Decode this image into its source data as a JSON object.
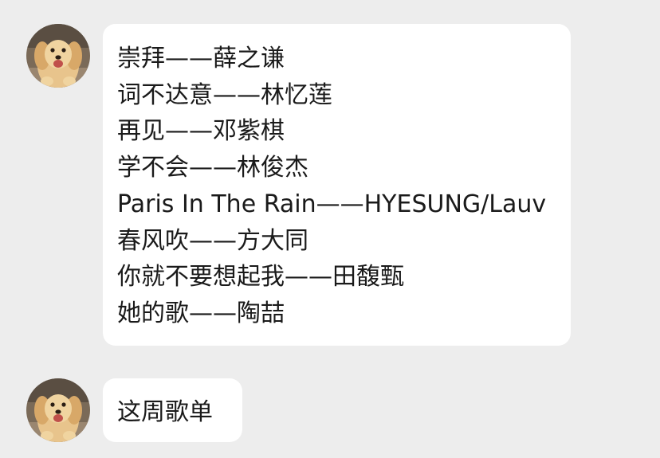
{
  "messages": [
    {
      "sender_avatar": "golden-retriever-puppy-avatar",
      "lines": [
        "崇拜——薛之谦",
        "词不达意——林忆莲",
        "再见——邓紫棋",
        "学不会——林俊杰",
        "Paris In The Rain——HYESUNG/Lauv",
        "春风吹——方大同",
        "你就不要想起我——田馥甄",
        "她的歌——陶喆"
      ]
    },
    {
      "sender_avatar": "golden-retriever-puppy-avatar",
      "lines": [
        "这周歌单"
      ]
    }
  ],
  "colors": {
    "background": "#ededed",
    "bubble": "#ffffff",
    "text": "#1a1a1a"
  }
}
